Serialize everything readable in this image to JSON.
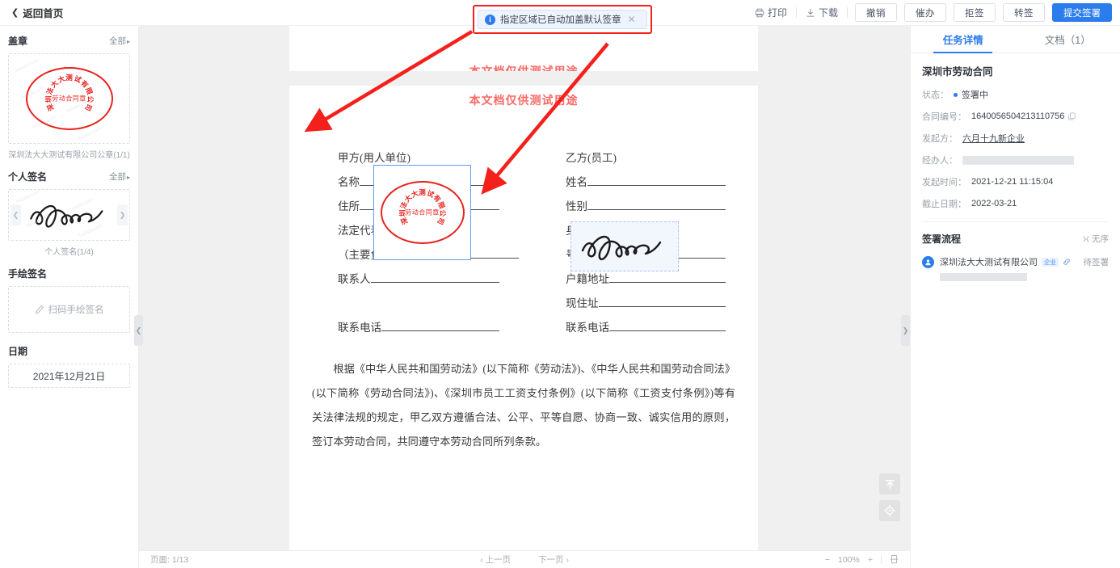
{
  "topbar": {
    "back_label": "返回首页",
    "print_label": "打印",
    "download_label": "下载",
    "buttons": [
      {
        "label": "撤销",
        "primary": false
      },
      {
        "label": "催办",
        "primary": false
      },
      {
        "label": "拒签",
        "primary": false
      },
      {
        "label": "转签",
        "primary": false
      },
      {
        "label": "提交签署",
        "primary": true
      }
    ]
  },
  "toast": {
    "message": "指定区域已自动加盖默认签章",
    "icon": "info-icon",
    "close": "✕",
    "highlight_color": "#f4201b"
  },
  "left_panel": {
    "seal": {
      "title": "盖章",
      "all_label": "全部",
      "caption": "深圳法大大测试有限公司公章(1/1)",
      "stamp_top": "深圳法大大测试有限公司",
      "stamp_mid": "劳动合同章",
      "watermark": "fadada.com"
    },
    "personal_sign": {
      "title": "个人签名",
      "all_label": "全部",
      "caption": "个人签名(1/4)"
    },
    "hand_sign": {
      "title": "手绘签名",
      "action_label": "扫码手绘签名"
    },
    "date": {
      "title": "日期",
      "value": "2021年12月21日"
    }
  },
  "document": {
    "watermark_red": "本文档仅供测试用途",
    "party_a_label": "甲方(用人单位)",
    "party_b_label": "乙方(员工)",
    "fields_left": [
      {
        "label": "名称",
        "underline": true
      },
      {
        "label": "住所",
        "underline": true
      },
      {
        "label": "法定代表人",
        "underline": false
      },
      {
        "label": "（主要负责人）",
        "underline": true,
        "short": true
      },
      {
        "label": "联系人",
        "underline": true
      },
      {
        "label": "",
        "underline": false
      },
      {
        "label": "联系电话",
        "underline": true
      }
    ],
    "fields_right": [
      {
        "label": "姓名",
        "underline": true
      },
      {
        "label": "性别",
        "underline": true
      },
      {
        "label": "身份证（护照）",
        "underline": false
      },
      {
        "label": "号码",
        "underline": true
      },
      {
        "label": "户籍地址",
        "underline": true
      },
      {
        "label": "现住址",
        "underline": true
      },
      {
        "label": "联系电话",
        "underline": true
      }
    ],
    "body_paragraph": "根据《中华人民共和国劳动法》(以下简称《劳动法》)、《中华人民共和国劳动合同法》(以下简称《劳动合同法》)、《深圳市员工工资支付条例》(以下简称《工资支付条例》)等有关法律法规的规定，甲乙双方遵循合法、公平、平等自愿、协商一致、诚实信用的原则，签订本劳动合同，共同遵守本劳动合同所列条款。"
  },
  "bottombar": {
    "page_label": "页面: 1/13",
    "prev_label": "‹ 上一页",
    "next_label": "下一页 ›",
    "zoom_out": "−",
    "zoom_level": "100%",
    "zoom_in": "+"
  },
  "right_panel": {
    "tabs": [
      {
        "label": "任务详情",
        "active": true
      },
      {
        "label": "文档（1）",
        "active": false
      }
    ],
    "doc_title": "深圳市劳动合同",
    "details": [
      {
        "key": "状态：",
        "value": "签署中",
        "type": "status"
      },
      {
        "key": "合同编号：",
        "value": "1640056504213110756",
        "type": "copy"
      },
      {
        "key": "发起方：",
        "value": "六月十九新企业",
        "type": "link"
      },
      {
        "key": "经办人：",
        "value": "",
        "type": "redacted"
      },
      {
        "key": "发起时间：",
        "value": "2021-12-21 11:15:04",
        "type": "text"
      },
      {
        "key": "截止日期：",
        "value": "2022-03-21",
        "type": "text"
      }
    ],
    "flow": {
      "title": "签署流程",
      "order_label": "无序",
      "items": [
        {
          "name": "深圳法大大测试有限公司",
          "tag": "企业",
          "status": "待签署"
        }
      ]
    }
  }
}
